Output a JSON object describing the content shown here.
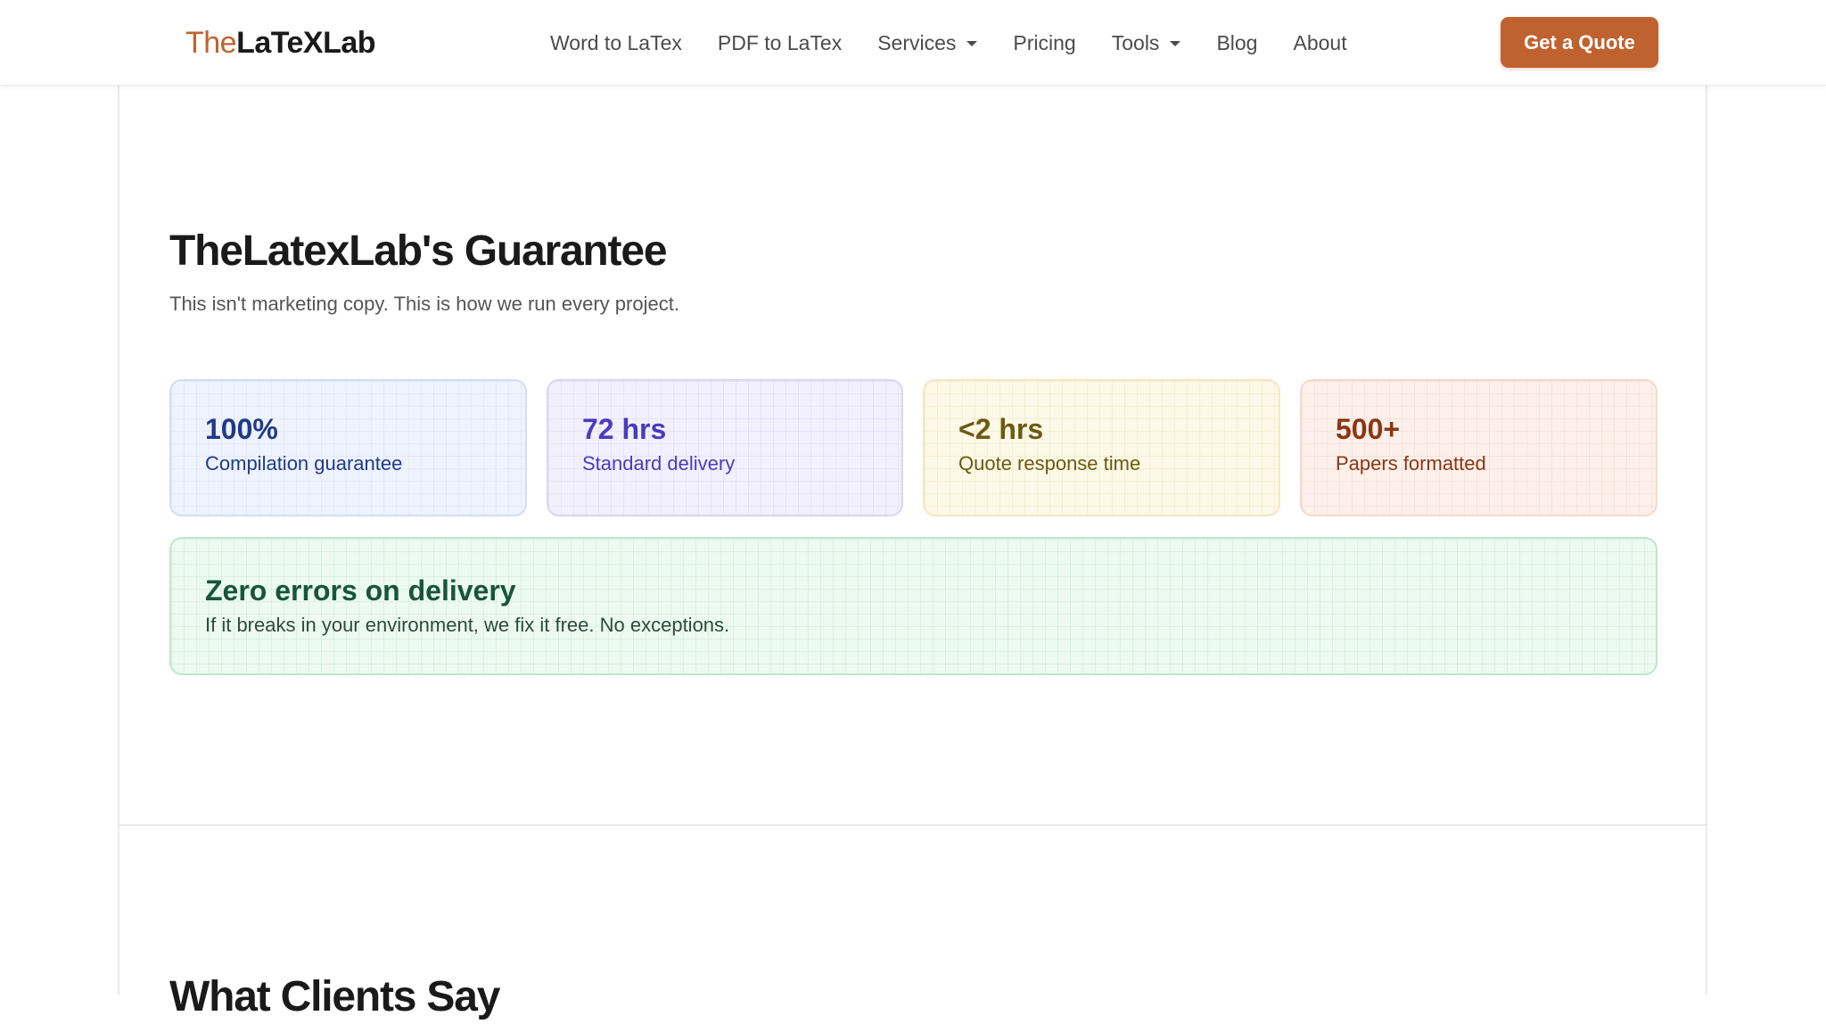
{
  "brand": {
    "logo_part1": "The",
    "logo_part2": "LaTeXLab",
    "accent_color": "#c0622f"
  },
  "nav": {
    "items": [
      {
        "label": "Word to LaTex",
        "dropdown": false
      },
      {
        "label": "PDF to LaTex",
        "dropdown": false
      },
      {
        "label": "Services",
        "dropdown": true
      },
      {
        "label": "Pricing",
        "dropdown": false
      },
      {
        "label": "Tools",
        "dropdown": true
      },
      {
        "label": "Blog",
        "dropdown": false
      },
      {
        "label": "About",
        "dropdown": false
      }
    ],
    "cta_label": "Get a Quote"
  },
  "guarantee": {
    "title": "TheLatexLab's Guarantee",
    "subtitle": "This isn't marketing copy. This is how we run every project.",
    "cards": [
      {
        "value": "100%",
        "label": "Compilation guarantee",
        "color": "#1f3a8a"
      },
      {
        "value": "72 hrs",
        "label": "Standard delivery",
        "color": "#4a3bbf"
      },
      {
        "value": "<2 hrs",
        "label": "Quote response time",
        "color": "#6b5a12"
      },
      {
        "value": "500+",
        "label": "Papers formatted",
        "color": "#8a3614"
      }
    ],
    "wide_card": {
      "title": "Zero errors on delivery",
      "text": "If it breaks in your environment, we fix it free. No exceptions.",
      "color": "#17553a"
    }
  },
  "testimonials": {
    "title": "What Clients Say"
  }
}
